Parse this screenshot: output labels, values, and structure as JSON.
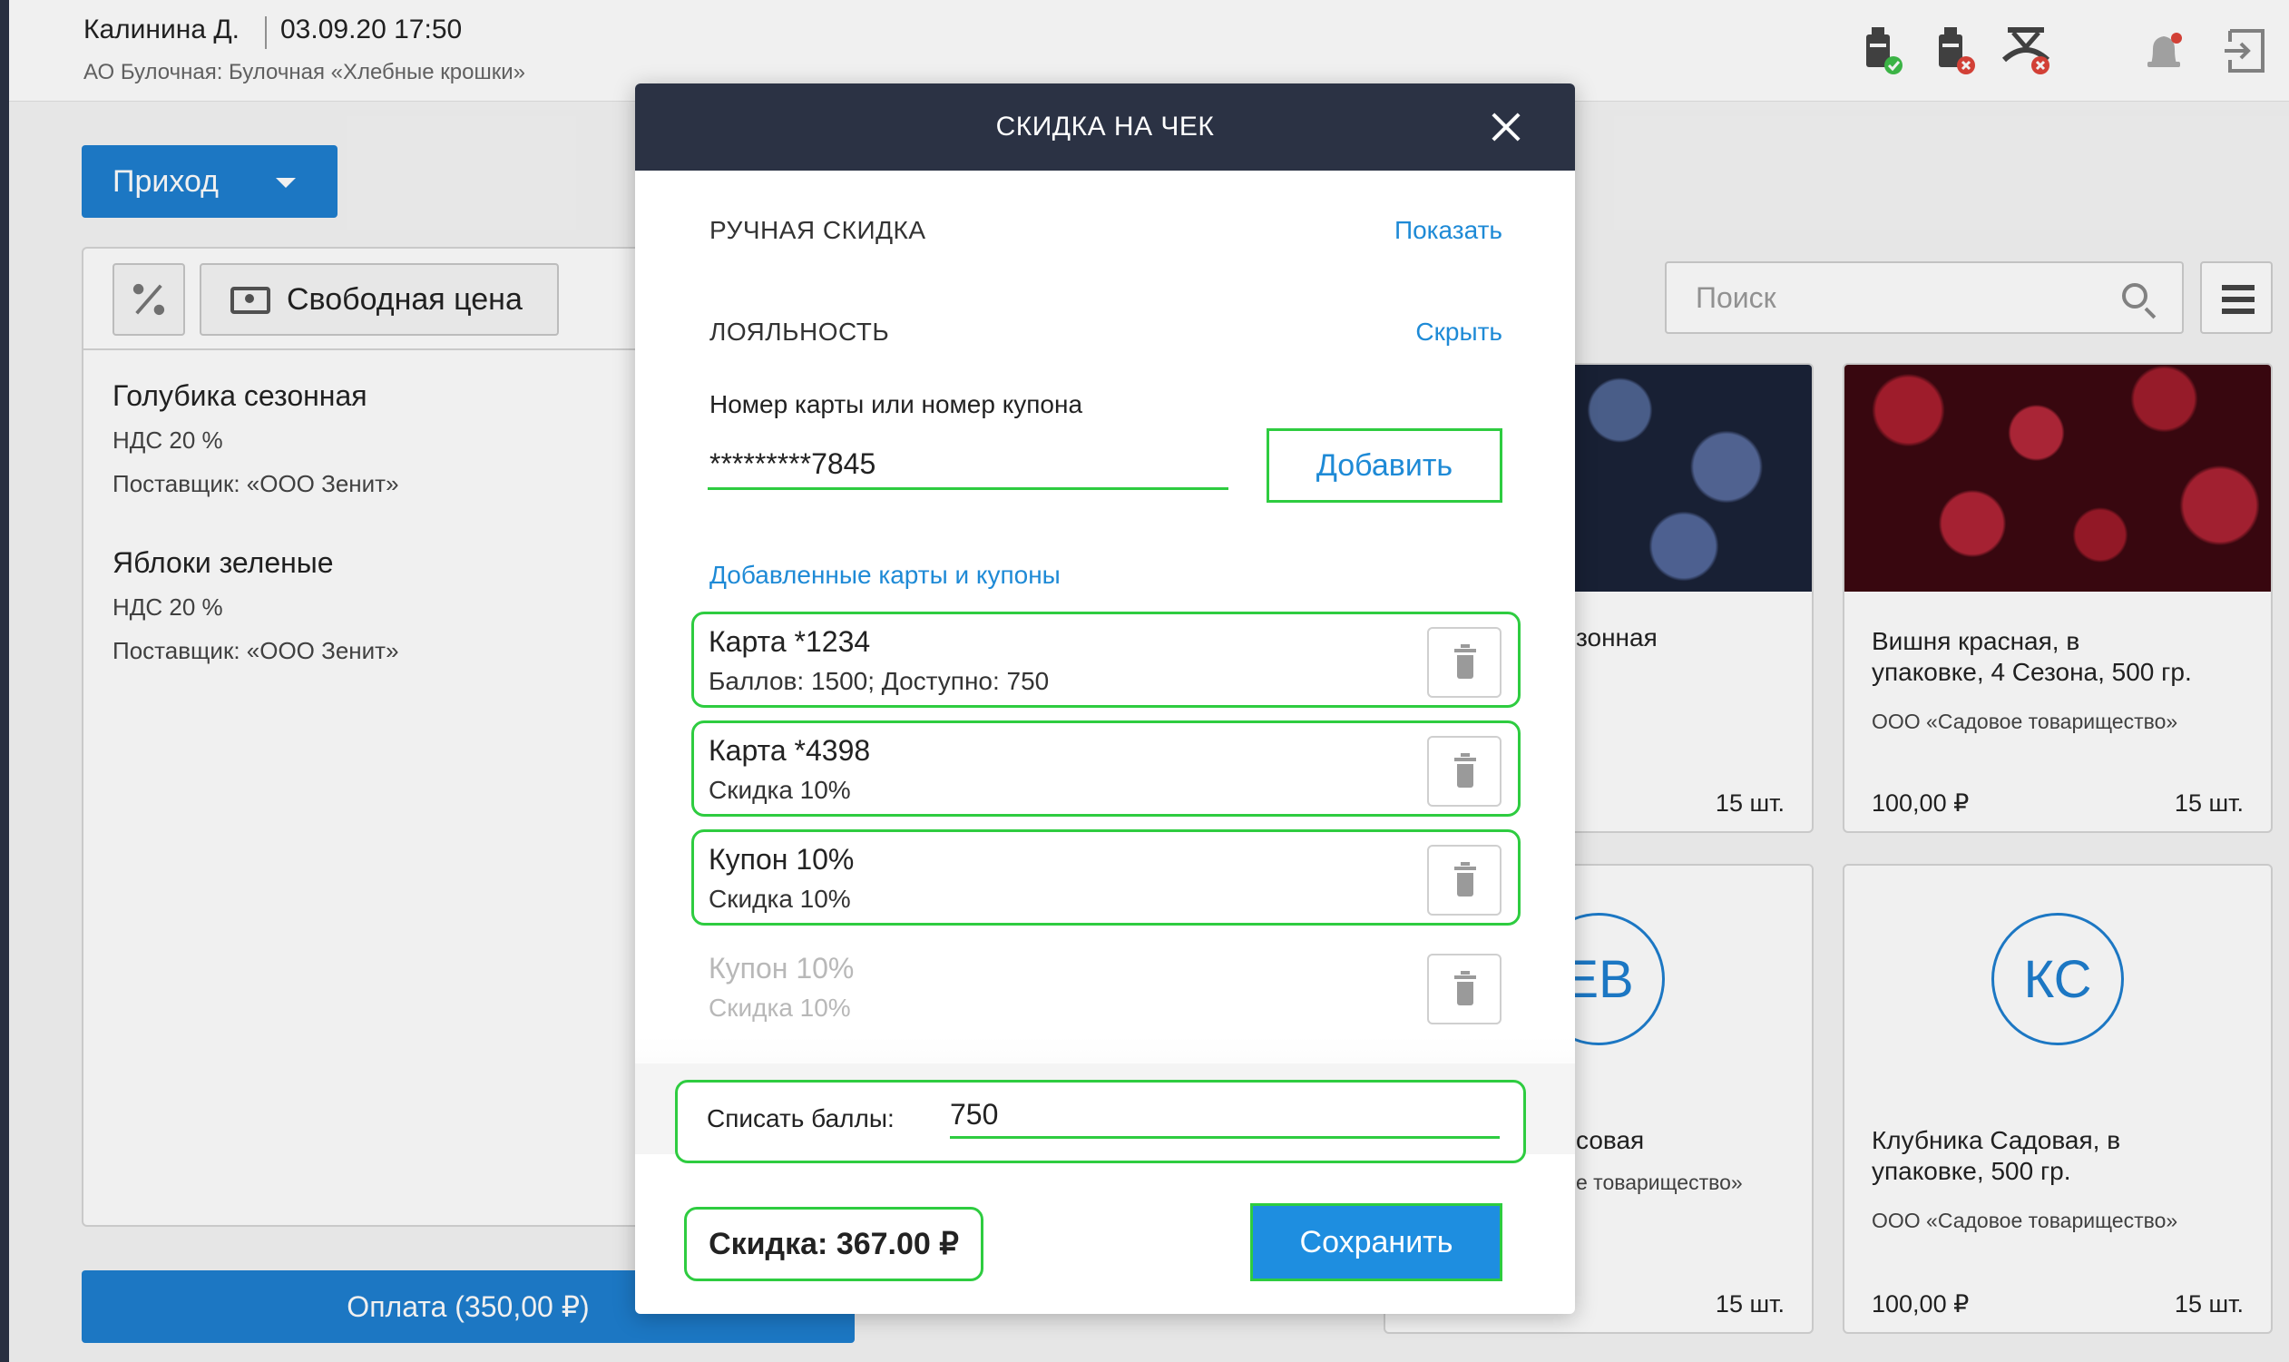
{
  "header": {
    "user": "Калинина Д.",
    "datetime": "03.09.20 17:50",
    "organization": "АО Булочная: Булочная «Хлебные крошки»"
  },
  "toolbar": {
    "income_label": "Приход",
    "free_price_label": "Свободная цена",
    "search_placeholder": "Поиск"
  },
  "cart": {
    "items": [
      {
        "name": "Голубика сезонная",
        "vat": "НДС 20 %",
        "supplier": "Поставщик: «ООО Зенит»"
      },
      {
        "name": "Яблоки зеленые",
        "vat": "НДС 20 %",
        "supplier": "Поставщик: «ООО Зенит»"
      }
    ],
    "pay_label": "Оплата (350,00 ₽)"
  },
  "products": {
    "partial_1_name": "зонная",
    "partial_1_qty": "15 шт.",
    "cherry": {
      "name_line1": "Вишня красная, в",
      "name_line2": "упаковке, 4 Сезона, 500 гр.",
      "supplier": "ООО «Садовое товарищество»",
      "price": "100,00 ₽",
      "qty": "15 шт."
    },
    "partial_2_initials": "ЕВ",
    "partial_2_name": "совая",
    "partial_2_supplier": "е товарищество»",
    "partial_2_qty": "15 шт.",
    "strawberry": {
      "initials": "КС",
      "name_line1": "Клубника Садовая, в",
      "name_line2": "упаковке, 500 гр.",
      "supplier": "ООО «Садовое товарищество»",
      "price": "100,00 ₽",
      "qty": "15 шт."
    }
  },
  "modal": {
    "title": "СКИДКА НА ЧЕК",
    "manual_section": "РУЧНАЯ СКИДКА",
    "manual_link": "Показать",
    "loyalty_section": "ЛОЯЛЬНОСТЬ",
    "loyalty_link": "Скрыть",
    "card_field_label": "Номер карты или номер купона",
    "card_field_value": "*********7845",
    "add_button": "Добавить",
    "added_title": "Добавленные карты и купоны",
    "coupons": [
      {
        "title": "Карта *1234",
        "subtitle": "Баллов: 1500; Доступно: 750",
        "active": true
      },
      {
        "title": "Карта *4398",
        "subtitle": "Скидка 10%",
        "active": true
      },
      {
        "title": "Купон 10%",
        "subtitle": "Скидка 10%",
        "active": true
      },
      {
        "title": "Купон 10%",
        "subtitle": "Скидка 10%",
        "active": false
      }
    ],
    "points_label": "Списать баллы:",
    "points_value": "750",
    "discount_text": "Скидка: 367.00 ₽",
    "save_button": "Сохранить"
  },
  "colors": {
    "accent": "#1e8ad6",
    "header_dark": "#2b3244",
    "highlight_green": "#2ecc40",
    "status_ok": "#3fbf4a",
    "status_error": "#e0453a"
  },
  "icons": [
    "printer-ok-icon",
    "printer-error-icon",
    "scale-error-icon",
    "bell-icon",
    "logout-icon",
    "percent-icon",
    "cash-icon",
    "search-icon",
    "list-view-icon",
    "close-icon",
    "trash-icon",
    "dropdown-caret-icon"
  ]
}
